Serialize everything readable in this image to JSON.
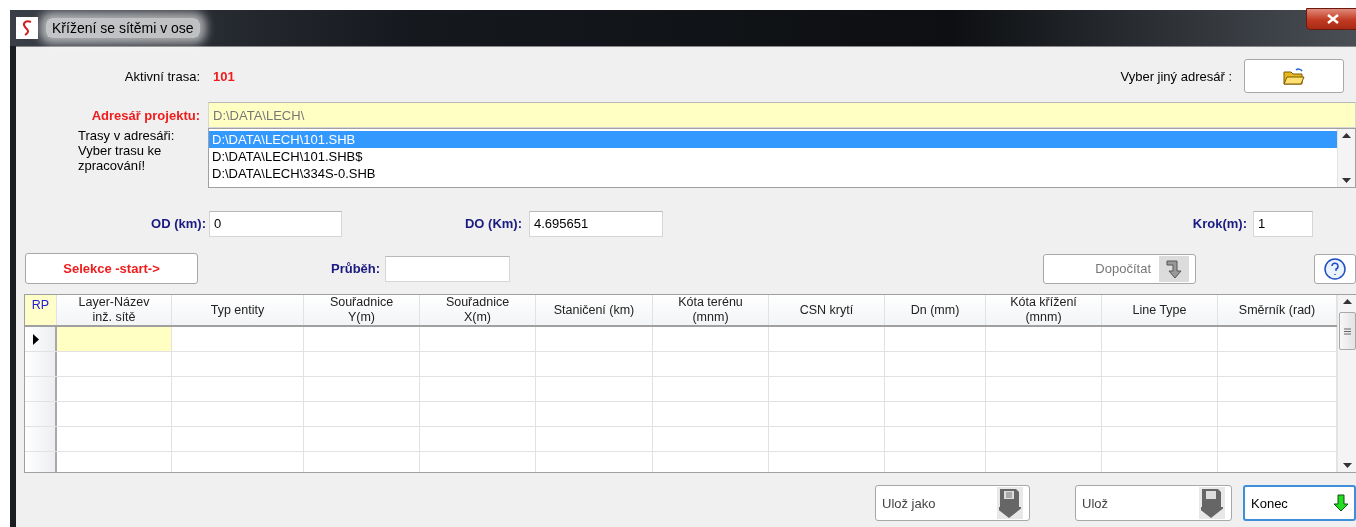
{
  "window": {
    "title": "Křížení se sítěmi v ose"
  },
  "active_route": {
    "label": "Aktivní trasa:",
    "value": "101"
  },
  "choose_dir": {
    "label": "Vyber jiný adresář :"
  },
  "project_dir": {
    "label": "Adresář projektu:",
    "value": "D:\\DATA\\LECH\\"
  },
  "routes": {
    "label": "Trasy v adresáři:\nVyber trasu ke\nzpracování!",
    "items": [
      {
        "text": "D:\\DATA\\LECH\\101.SHB",
        "selected": true
      },
      {
        "text": "D:\\DATA\\LECH\\101.SHB$",
        "selected": false
      },
      {
        "text": "D:\\DATA\\LECH\\334S-0.SHB",
        "selected": false
      }
    ]
  },
  "od": {
    "label": "OD (km):",
    "value": "0"
  },
  "do": {
    "label": "DO (Km):",
    "value": "4.695651"
  },
  "krok": {
    "label": "Krok(m):",
    "value": "1"
  },
  "select_button": "Selekce -start->",
  "progress": {
    "label": "Průběh:"
  },
  "recalc_button": {
    "label": "Dopočítat",
    "disabled": true
  },
  "table": {
    "columns": [
      "RP",
      "Layer-Název\ninž. sítě",
      "Typ entity",
      "Souřadnice\nY(m)",
      "Souřadnice\nX(m)",
      "Staničení (km)",
      "Kóta terénu\n(mnm)",
      "CSN krytí",
      "Dn (mm)",
      "Kóta křížení\n(mnm)",
      "Line Type",
      "Směrník (rad)"
    ],
    "rows": [
      {
        "current": true
      },
      {
        "current": false
      },
      {
        "current": false
      },
      {
        "current": false
      },
      {
        "current": false
      },
      {
        "current": false
      }
    ]
  },
  "buttons": [
    {
      "kind": "save-as",
      "label": "Ulož jako",
      "focused": false
    },
    {
      "kind": "save",
      "label": "Ulož",
      "focused": false
    },
    {
      "kind": "exit",
      "label": "Konec",
      "focused": true
    }
  ]
}
